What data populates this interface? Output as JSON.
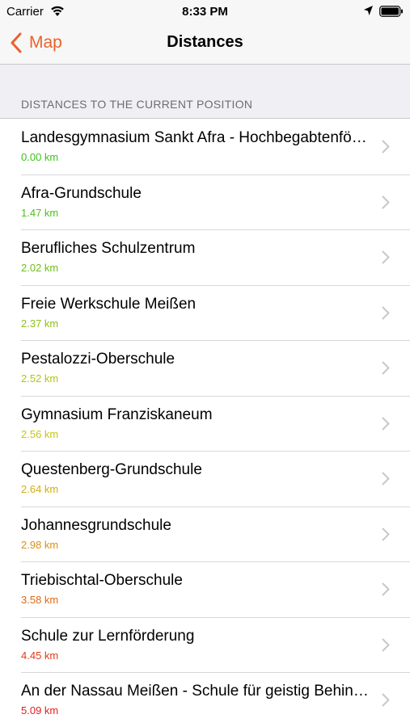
{
  "status": {
    "carrier": "Carrier",
    "time": "8:33 PM",
    "icons": [
      "wifi-icon",
      "location-arrow-icon",
      "battery-icon"
    ]
  },
  "nav": {
    "back_label": "Map",
    "title": "Distances",
    "accent_color": "#e8622c"
  },
  "section": {
    "header": "DISTANCES TO THE CURRENT POSITION"
  },
  "items": [
    {
      "title": "Landesgymnasium Sankt Afra - Hochbegabtenförderung",
      "distance": "0.00 km",
      "color": "#3ec21c"
    },
    {
      "title": "Afra-Grundschule",
      "distance": "1.47 km",
      "color": "#4cc21c"
    },
    {
      "title": "Berufliches Schulzentrum",
      "distance": "2.02 km",
      "color": "#6cbf1c"
    },
    {
      "title": "Freie Werkschule Meißen",
      "distance": "2.37 km",
      "color": "#8fc01a"
    },
    {
      "title": "Pestalozzi-Oberschule",
      "distance": "2.52 km",
      "color": "#b4c414"
    },
    {
      "title": "Gymnasium Franziskaneum",
      "distance": "2.56 km",
      "color": "#c8c414"
    },
    {
      "title": "Questenberg-Grundschule",
      "distance": "2.64 km",
      "color": "#d2ae12"
    },
    {
      "title": "Johannesgrundschule",
      "distance": "2.98 km",
      "color": "#d99212"
    },
    {
      "title": "Triebischtal-Oberschule",
      "distance": "3.58 km",
      "color": "#dd6a14"
    },
    {
      "title": "Schule zur Lernförderung",
      "distance": "4.45 km",
      "color": "#e03a18"
    },
    {
      "title": "An der Nassau Meißen - Schule für geistig Behinderte",
      "distance": "5.09 km",
      "color": "#e0201c"
    }
  ]
}
